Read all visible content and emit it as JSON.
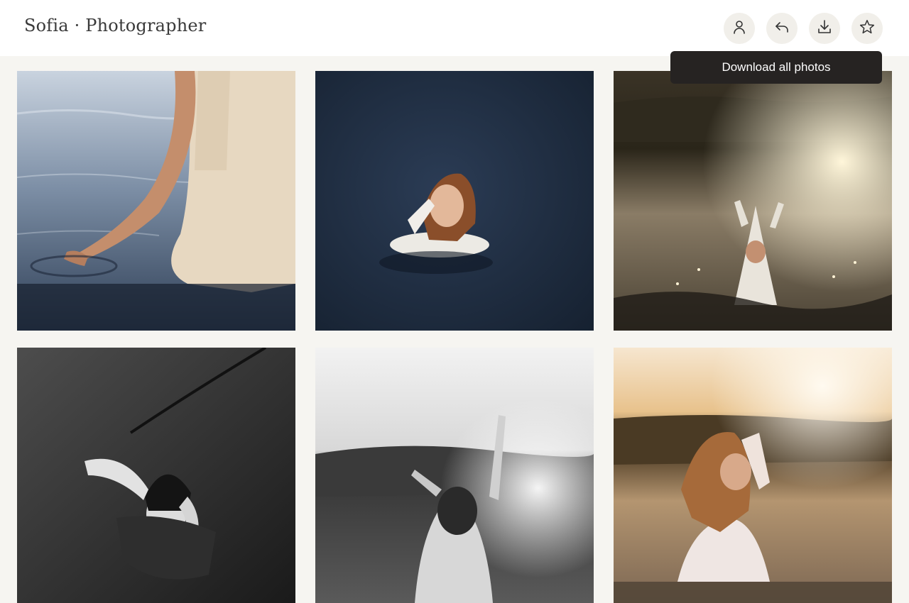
{
  "header": {
    "brand": "Sofia · Photographer",
    "actions": [
      {
        "icon": "user-icon"
      },
      {
        "icon": "reply-icon"
      },
      {
        "icon": "download-icon"
      },
      {
        "icon": "star-icon"
      }
    ]
  },
  "tooltip": {
    "text": "Download all photos"
  },
  "gallery": {
    "photos": [
      {
        "subject": "hand-in-water"
      },
      {
        "subject": "woman-floating-dark-water"
      },
      {
        "subject": "sunset-splash"
      },
      {
        "subject": "bw-portrait-water"
      },
      {
        "subject": "bw-raised-arms"
      },
      {
        "subject": "sunset-shirt"
      }
    ]
  },
  "colors": {
    "page_bg": "#f6f5f1",
    "header_bg": "#ffffff",
    "tooltip_bg": "#262322",
    "icon_bg": "#f1efea"
  }
}
